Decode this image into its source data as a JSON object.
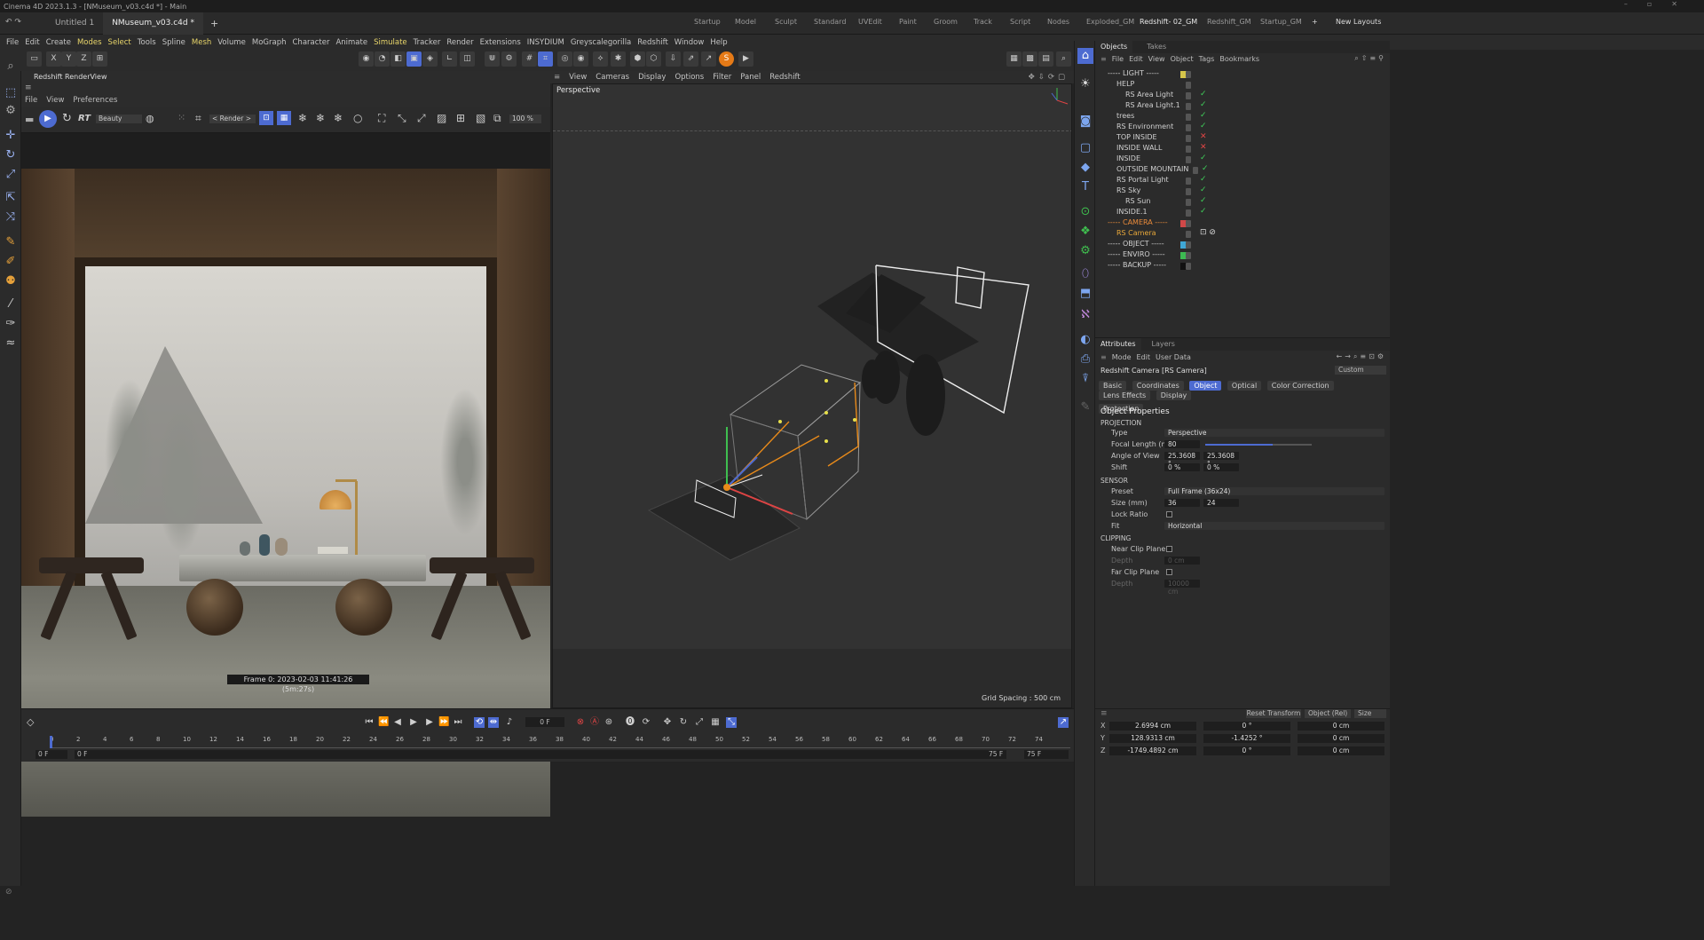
{
  "window": {
    "title": "Cinema 4D 2023.1.3 - [NMuseum_v03.c4d *] - Main"
  },
  "doc_tabs": [
    "Untitled 1",
    "NMuseum_v03.c4d *"
  ],
  "layouts": [
    "Startup",
    "Model",
    "Sculpt",
    "Standard",
    "UVEdit",
    "Paint",
    "Groom",
    "Track",
    "Script",
    "Nodes",
    "Exploded_GM",
    "Redshift- 02_GM",
    "Redshift_GM",
    "Startup_GM"
  ],
  "new_layouts": "New Layouts",
  "menu": [
    "File",
    "Edit",
    "Create",
    "Modes",
    "Select",
    "Tools",
    "Spline",
    "Mesh",
    "Volume",
    "MoGraph",
    "Character",
    "Animate",
    "Simulate",
    "Tracker",
    "Render",
    "Extensions",
    "INSYDIUM",
    "Greyscalegorilla",
    "Redshift",
    "Window",
    "Help"
  ],
  "axis_toggles": [
    "X",
    "Y",
    "Z"
  ],
  "renderview": {
    "title": "Redshift RenderView",
    "menu": [
      "File",
      "View",
      "Preferences"
    ],
    "rt_label": "RT",
    "aov": "Beauty",
    "camera": "< Render >",
    "zoom": "100 %",
    "status": "Frame 0:  2023-02-03  11:41:26  (5m:27s)"
  },
  "viewport": {
    "menu": [
      "View",
      "Cameras",
      "Display",
      "Options",
      "Filter",
      "Panel",
      "Redshift"
    ],
    "label": "Perspective",
    "grid": "Grid Spacing : 500 cm"
  },
  "objects": {
    "tabs": [
      "Objects",
      "Takes"
    ],
    "menu": [
      "File",
      "Edit",
      "View",
      "Object",
      "Tags",
      "Bookmarks"
    ],
    "items": [
      {
        "name": "----- LIGHT -----",
        "indent": 0,
        "mark": "",
        "color": "#d6c54a"
      },
      {
        "name": "HELP",
        "indent": 1,
        "mark": "",
        "color": ""
      },
      {
        "name": "RS Area Light",
        "indent": 2,
        "mark": "✓",
        "color": ""
      },
      {
        "name": "RS Area Light.1",
        "indent": 2,
        "mark": "✓",
        "color": ""
      },
      {
        "name": "trees",
        "indent": 1,
        "mark": "✓",
        "color": ""
      },
      {
        "name": "RS Environment",
        "indent": 1,
        "mark": "✓",
        "color": ""
      },
      {
        "name": "TOP INSIDE",
        "indent": 1,
        "mark": "✕",
        "color": ""
      },
      {
        "name": "INSIDE WALL",
        "indent": 1,
        "mark": "✕",
        "color": ""
      },
      {
        "name": "INSIDE",
        "indent": 1,
        "mark": "✓",
        "color": ""
      },
      {
        "name": "OUTSIDE MOUNTAIN",
        "indent": 1,
        "mark": "✓",
        "color": ""
      },
      {
        "name": "RS Portal Light",
        "indent": 1,
        "mark": "✓",
        "color": ""
      },
      {
        "name": "RS Sky",
        "indent": 1,
        "mark": "✓",
        "color": ""
      },
      {
        "name": "RS Sun",
        "indent": 2,
        "mark": "✓",
        "color": ""
      },
      {
        "name": "INSIDE.1",
        "indent": 1,
        "mark": "✓",
        "color": ""
      },
      {
        "name": "----- CAMERA -----",
        "indent": 0,
        "mark": "",
        "color": "#d04848"
      },
      {
        "name": "RS Camera",
        "indent": 1,
        "mark": "",
        "color": ""
      },
      {
        "name": "----- OBJECT -----",
        "indent": 0,
        "mark": "",
        "color": "#3fa7d6"
      },
      {
        "name": "----- ENVIRO -----",
        "indent": 0,
        "mark": "",
        "color": "#3dba52"
      },
      {
        "name": "----- BACKUP -----",
        "indent": 0,
        "mark": "",
        "color": "#111111"
      }
    ]
  },
  "attributes": {
    "tabs": [
      "Attributes",
      "Layers"
    ],
    "menu": [
      "Mode",
      "Edit",
      "User Data"
    ],
    "object_title": "Redshift Camera [RS Camera]",
    "preset_dropdown": "Custom",
    "subtabs": [
      "Basic",
      "Coordinates",
      "Object",
      "Optical",
      "Color Correction",
      "Lens Effects",
      "Display"
    ],
    "protection": "Protection",
    "section": "Object Properties",
    "projection_header": "PROJECTION",
    "type_label": "Type",
    "type_value": "Perspective",
    "focal_label": "Focal Length (mm)",
    "focal_value": "80",
    "aov_label": "Angle of View",
    "aov_h": "25.3608 °",
    "aov_v": "25.3608 °",
    "shift_label": "Shift",
    "shift_x": "0 %",
    "shift_y": "0 %",
    "sensor_header": "SENSOR",
    "preset_label": "Preset",
    "preset_value": "Full Frame (36x24)",
    "size_label": "Size (mm)",
    "size_w": "36",
    "size_h": "24",
    "lockratio_label": "Lock Ratio",
    "fit_label": "Fit",
    "fit_value": "Horizontal",
    "clipping_header": "CLIPPING",
    "near_label": "Near Clip Plane",
    "near_depth_label": "Depth",
    "near_depth": "0 cm",
    "far_label": "Far Clip Plane",
    "far_depth_label": "Depth",
    "far_depth": "10000 cm"
  },
  "coords": {
    "reset": "Reset Transform",
    "mode": "Object (Rel)",
    "size": "Size",
    "rows": [
      {
        "axis": "X",
        "pos": "2.6994 cm",
        "rot": "0 °",
        "size": "0 cm"
      },
      {
        "axis": "Y",
        "pos": "128.9313 cm",
        "rot": "-1.4252 °",
        "size": "0 cm"
      },
      {
        "axis": "Z",
        "pos": "-1749.4892 cm",
        "rot": "0 °",
        "size": "0 cm"
      }
    ]
  },
  "timeline": {
    "current": "0 F",
    "start": "0 F",
    "start2": "0 F",
    "end": "75 F",
    "end2": "75 F",
    "ticks": [
      "0",
      "2",
      "4",
      "6",
      "8",
      "10",
      "12",
      "14",
      "16",
      "18",
      "20",
      "22",
      "24",
      "26",
      "28",
      "30",
      "32",
      "34",
      "36",
      "38",
      "40",
      "42",
      "44",
      "46",
      "48",
      "50",
      "52",
      "54",
      "56",
      "58",
      "60",
      "62",
      "64",
      "66",
      "68",
      "70",
      "72",
      "74"
    ]
  },
  "colors": {
    "accent": "#4d6bd1",
    "highlight_menu": "#e8d56a",
    "ok": "#3fcf5a",
    "off": "#e04545"
  }
}
